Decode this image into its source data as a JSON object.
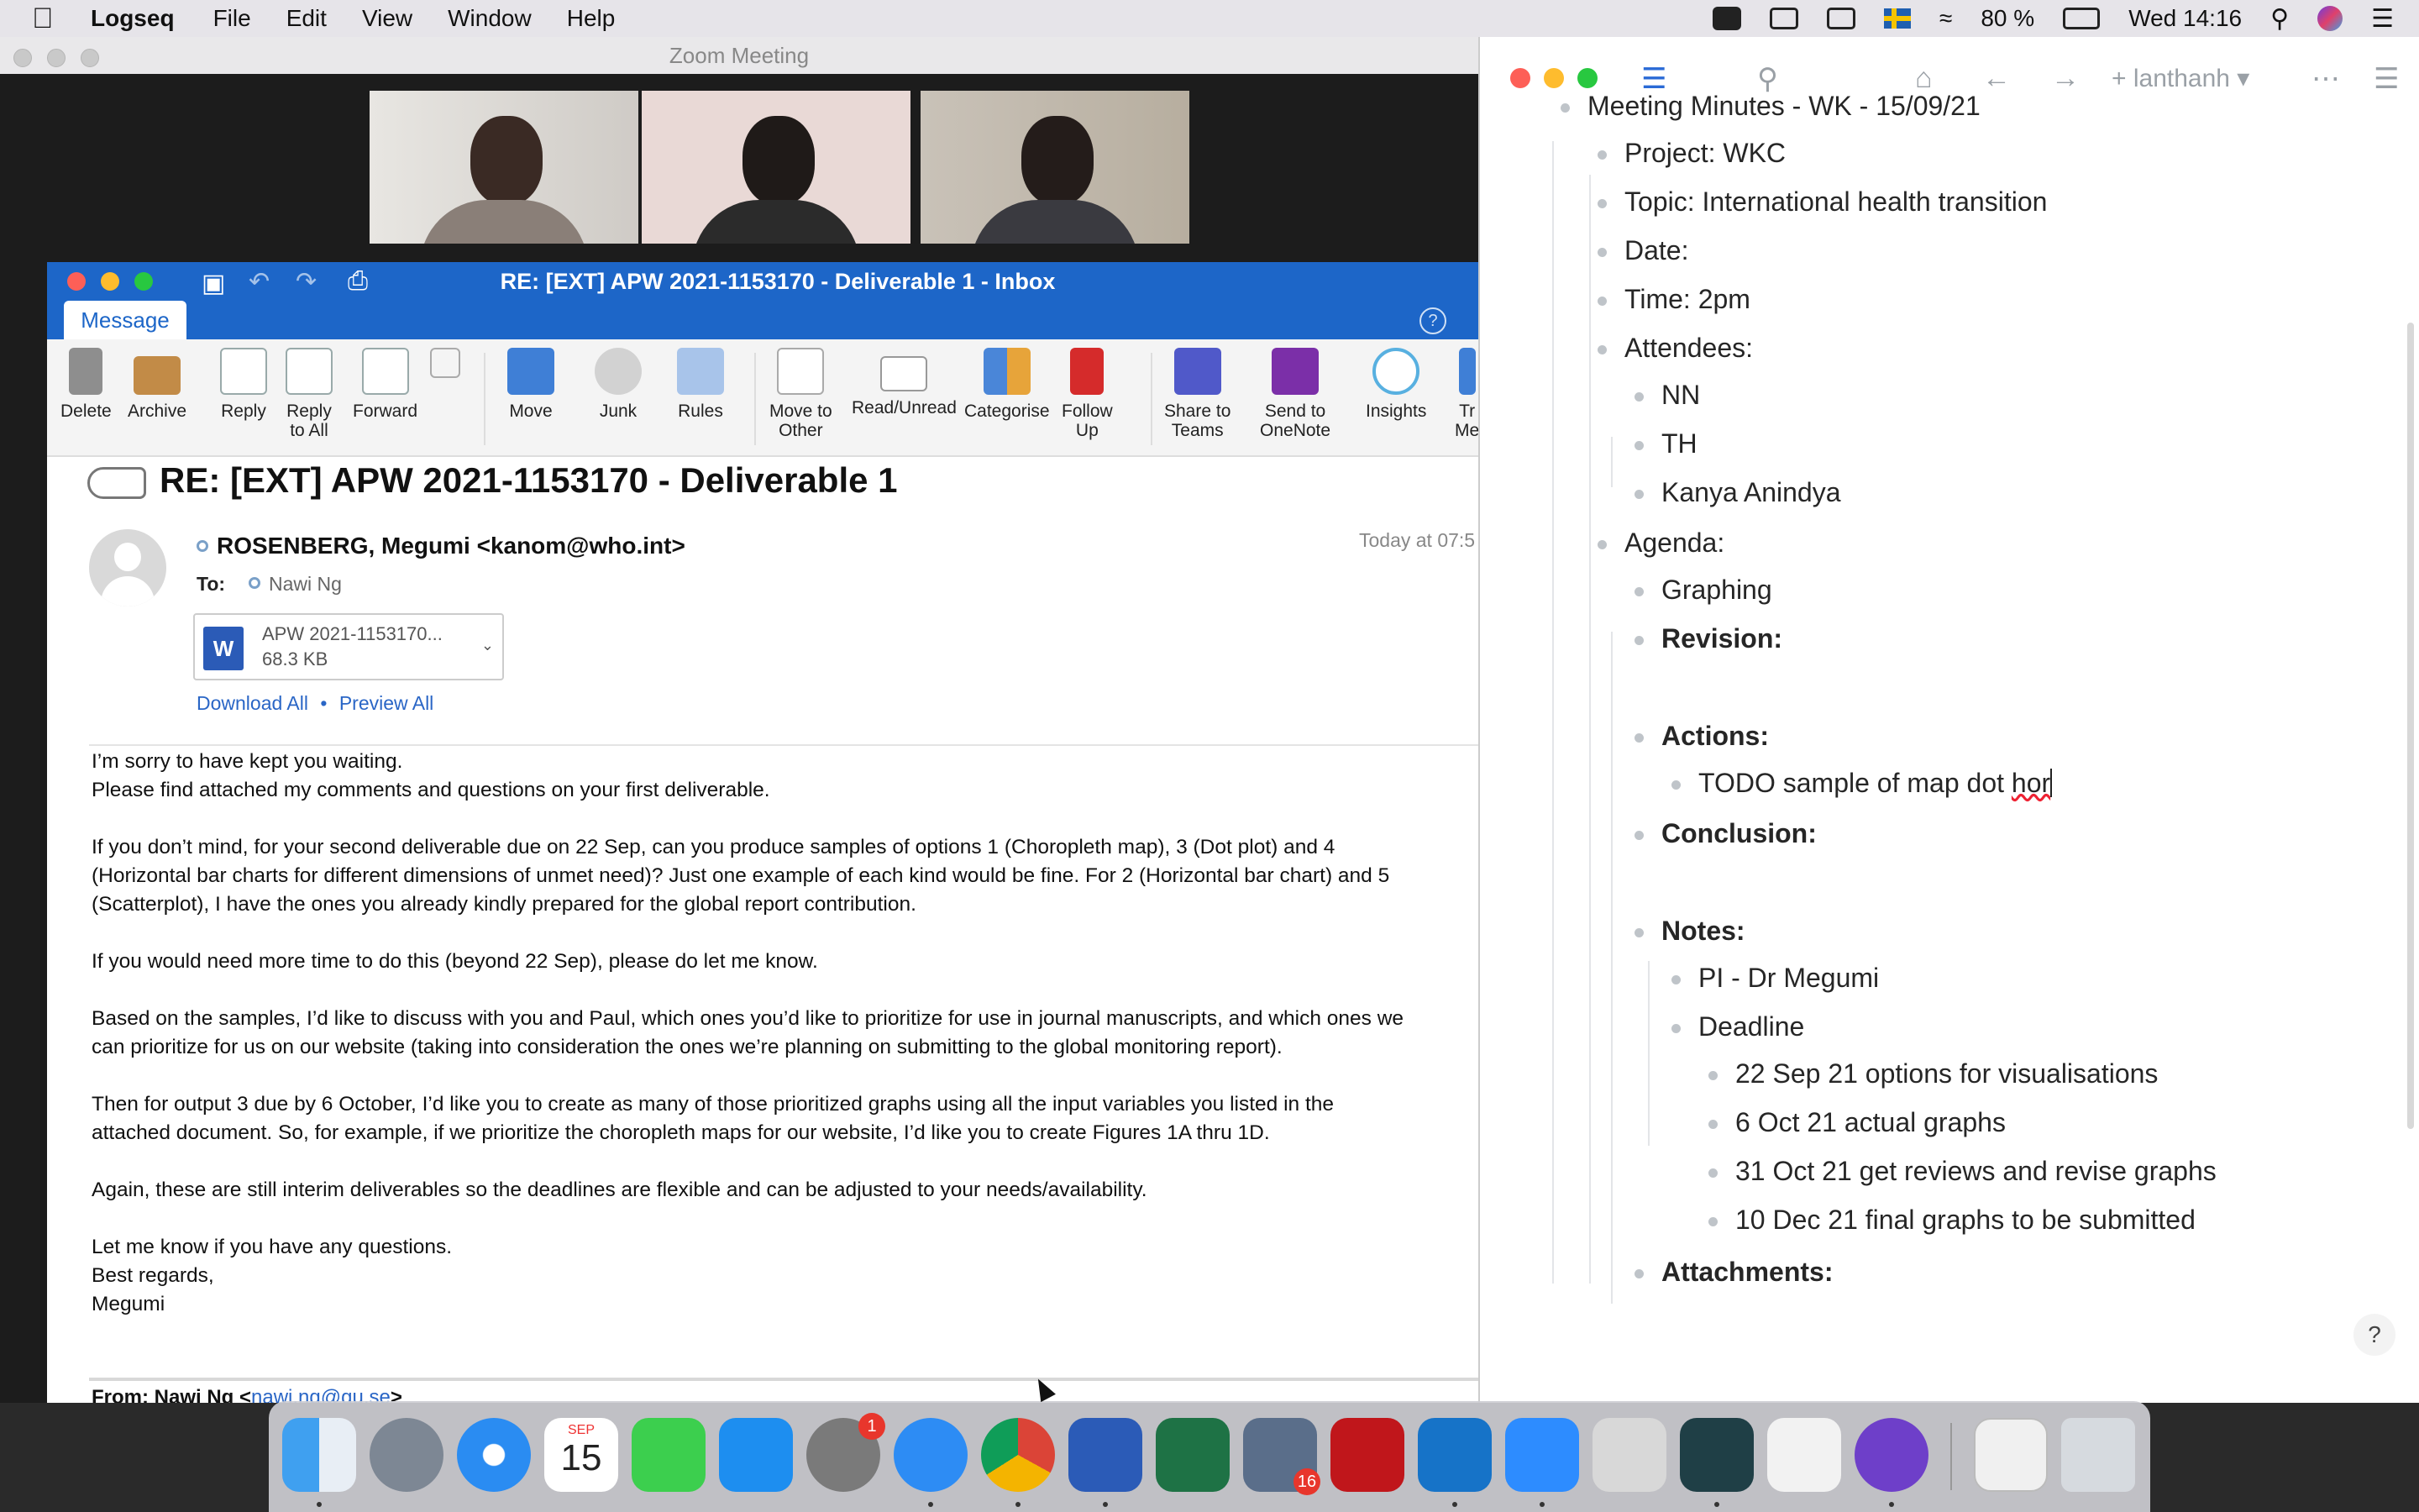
{
  "menubar": {
    "app_name": "Logseq",
    "menus": [
      "File",
      "Edit",
      "View",
      "Window",
      "Help"
    ],
    "battery": "80 %",
    "clock": "Wed 14:16"
  },
  "zoom": {
    "title": "Zoom Meeting"
  },
  "outlook": {
    "window_title": "RE: [EXT] APW 2021-1153170 - Deliverable 1 - Inbox",
    "tab": "Message",
    "ribbon": {
      "delete": "Delete",
      "archive": "Archive",
      "reply": "Reply",
      "reply_all": "Reply\nto All",
      "forward": "Forward",
      "move": "Move",
      "junk": "Junk",
      "rules": "Rules",
      "move_to_other": "Move to\nOther",
      "read_unread": "Read/Unread",
      "categorise": "Categorise",
      "follow_up": "Follow\nUp",
      "share_to_teams": "Share to\nTeams",
      "send_to_onenote": "Send to\nOneNote",
      "insights": "Insights",
      "truncated": "Tr\nMe"
    },
    "subject": "RE: [EXT] APW 2021-1153170 - Deliverable 1",
    "sender": "ROSENBERG, Megumi <kanom@who.int>",
    "sent_time": "Today at 07:5",
    "to_label": "To:",
    "to_value": "Nawi Ng",
    "attachment": {
      "name": "APW 2021-1153170...",
      "size": "68.3 KB"
    },
    "download_all": "Download All",
    "link_separator": "•",
    "preview_all": "Preview All",
    "body": [
      "I’m sorry to have kept you waiting.\nPlease find attached my comments and questions on your first deliverable.",
      "If you don’t mind, for your second deliverable due on 22 Sep, can you produce samples of options 1 (Choropleth map), 3 (Dot plot) and 4\n(Horizontal bar charts for different dimensions of unmet need)? Just one example of each kind would be fine. For 2 (Horizontal bar chart) and 5\n(Scatterplot), I have the ones you already kindly prepared for the global report contribution.",
      "If you would need more time to do this (beyond 22 Sep), please do let me know.",
      "Based on the samples, I’d like to discuss with you and Paul, which ones you’d like to prioritize for use in journal manuscripts, and which ones we\ncan prioritize for us on our website (taking into consideration the ones we’re planning on submitting to the global monitoring report).",
      "Then for output 3 due by 6 October, I’d like you to create as many of those prioritized graphs using all the input variables you listed in the\nattached document. So, for example, if we prioritize the choropleth maps for our website, I’d like you to create Figures 1A thru 1D.",
      "Again, these are still interim deliverables so the deadlines are flexible and can be adjusted to your needs/availability.",
      "Let me know if you have any questions.\nBest regards,\nMegumi"
    ],
    "from_prefix": "From: Nawi Ng <",
    "from_email": "nawi.ng@gu.se",
    "from_suffix": ">"
  },
  "logseq": {
    "user": "lanthanh",
    "blocks": {
      "title": "Meeting Minutes - WK - 15/09/21",
      "project": "Project: WKC",
      "topic": "Topic: International health transition",
      "date": "Date:",
      "time": "Time: 2pm",
      "attendees": "Attendees:",
      "att1": "NN",
      "att2": "TH",
      "att3": "Kanya Anindya",
      "agenda": "Agenda:",
      "graphing": "Graphing",
      "revision": "Revision:",
      "actions": "Actions:",
      "todo_text": "TODO sample of map dot ",
      "todo_typo": "hor",
      "conclusion": "Conclusion:",
      "notes": "Notes:",
      "pi": "PI - Dr Megumi",
      "deadline": "Deadline",
      "d1": "22 Sep 21 options for visualisations",
      "d2": "6 Oct 21 actual graphs",
      "d3": "31 Oct 21 get reviews and revise graphs",
      "d4": "10 Dec 21 final graphs to be submitted",
      "attachments": "Attachments:"
    },
    "help": "?"
  },
  "dock": {
    "calendar_month": "SEP",
    "calendar_day": "15",
    "system_prefs_badge": "1",
    "launchpad_badge": "16"
  },
  "colors": {
    "outlook_blue": "#1d66c8",
    "logseq_text": "#262626",
    "link_blue": "#2a66c6"
  }
}
